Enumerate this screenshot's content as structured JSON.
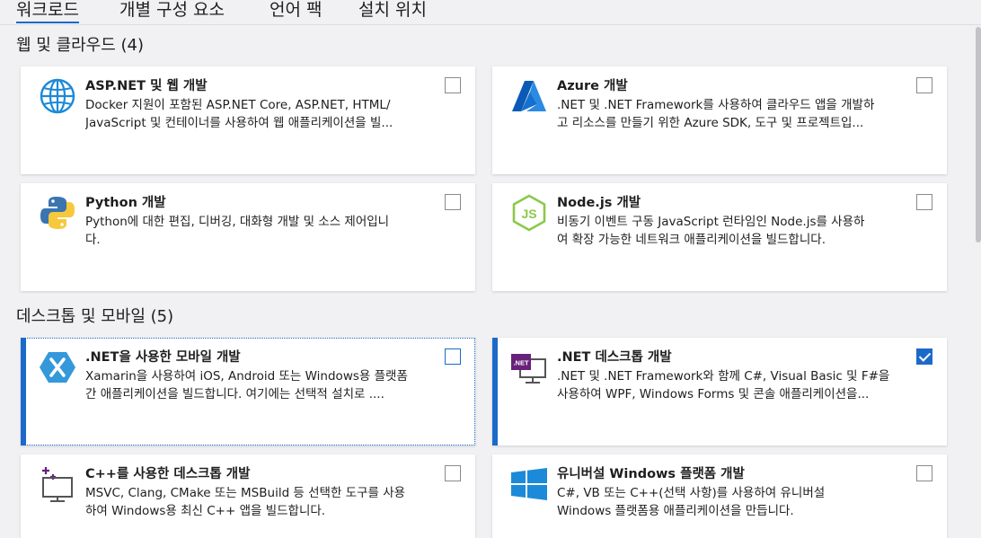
{
  "tabs": [
    {
      "label": "워크로드"
    },
    {
      "label": "개별 구성 요소"
    },
    {
      "label": "언어 팩"
    },
    {
      "label": "설치 위치"
    }
  ],
  "sections": [
    {
      "title": "웹 및 클라우드 (4)"
    },
    {
      "title": "데스크톱 및 모바일 (5)"
    }
  ],
  "workloads": [
    {
      "title": "ASP.NET 및 웹 개발",
      "description": "Docker 지원이 포함된 ASP.NET Core, ASP.NET, HTML/\nJavaScript 및 컨테이너를 사용하여 웹 애플리케이션을 빌...",
      "icon": "globe-icon",
      "checked": false
    },
    {
      "title": "Azure 개발",
      "description": ".NET 및 .NET Framework를 사용하여 클라우드 앱을 개발하\n고 리소스를 만들기 위한 Azure SDK, 도구 및 프로젝트입...",
      "icon": "azure-icon",
      "checked": false
    },
    {
      "title": "Python 개발",
      "description": "Python에 대한 편집, 디버깅, 대화형 개발 및 소스 제어입니\n다.",
      "icon": "python-icon",
      "checked": false
    },
    {
      "title": "Node.js 개발",
      "description": "비동기 이벤트 구동 JavaScript 런타임인 Node.js를 사용하\n여 확장 가능한 네트워크 애플리케이션을 빌드합니다.",
      "icon": "nodejs-icon",
      "checked": false
    },
    {
      "title": ".NET을 사용한 모바일 개발",
      "description": "Xamarin을 사용하여 iOS, Android 또는 Windows용 플랫폼\n간 애플리케이션을 빌드합니다. 여기에는 선택적 설치로 ....",
      "icon": "xamarin-icon",
      "checked": false
    },
    {
      "title": ".NET 데스크톱 개발",
      "description": ".NET 및 .NET Framework와 함께 C#, Visual Basic 및 F#을\n사용하여 WPF, Windows Forms 및 콘솔 애플리케이션을...",
      "icon": "dotnet-desktop-icon",
      "icon_badge": ".NET",
      "checked": true
    },
    {
      "title": "C++를 사용한 데스크톱 개발",
      "description": "MSVC, Clang, CMake 또는 MSBuild 등 선택한 도구를 사용\n하여 Windows용 최신 C++ 앱을 빌드합니다.",
      "icon": "cpp-desktop-icon",
      "checked": false
    },
    {
      "title": "유니버설 Windows 플랫폼 개발",
      "description": "C#, VB 또는 C++(선택 사항)를 사용하여 유니버설\nWindows 플랫폼용 애플리케이션을 만듭니다.",
      "icon": "windows-icon",
      "checked": false
    }
  ],
  "colors": {
    "accent": "#1b6ac9",
    "background": "#f1f1f4",
    "card": "#ffffff",
    "dotnet_purple": "#68217a",
    "node_green": "#8cc84b"
  }
}
